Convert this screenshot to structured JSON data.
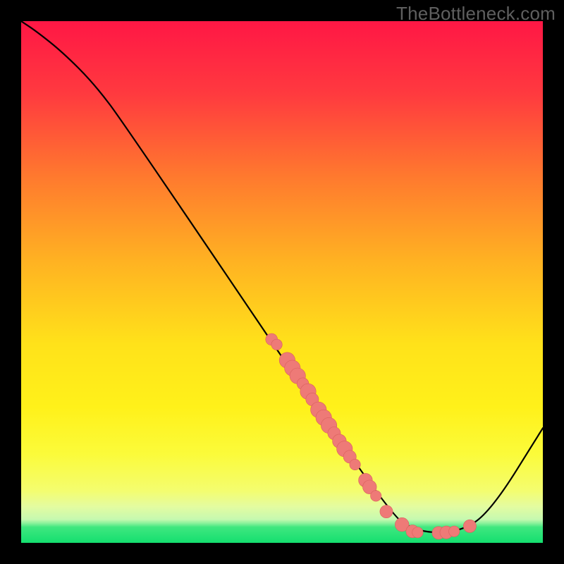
{
  "watermark": "TheBottleneck.com",
  "colors": {
    "frame": "#000000",
    "top_gradient": "#ff1846",
    "mid_gradient": "#ffe400",
    "bottom_band": "#15e070",
    "curve": "#000000",
    "point_fill": "#ee7a77",
    "point_stroke": "#d9605d"
  },
  "chart_data": {
    "type": "line",
    "title": "",
    "xlabel": "",
    "ylabel": "",
    "xlim": [
      0,
      100
    ],
    "ylim": [
      0,
      100
    ],
    "curve": [
      {
        "x": 0,
        "y": 100
      },
      {
        "x": 3,
        "y": 98
      },
      {
        "x": 8,
        "y": 94
      },
      {
        "x": 14,
        "y": 88
      },
      {
        "x": 20,
        "y": 80
      },
      {
        "x": 70,
        "y": 6
      },
      {
        "x": 76,
        "y": 2
      },
      {
        "x": 84,
        "y": 2
      },
      {
        "x": 90,
        "y": 6
      },
      {
        "x": 100,
        "y": 22
      }
    ],
    "series": [
      {
        "name": "points",
        "values": [
          {
            "x": 48,
            "y": 39,
            "r": 1.2
          },
          {
            "x": 49,
            "y": 38,
            "r": 1.1
          },
          {
            "x": 51,
            "y": 35,
            "r": 1.6
          },
          {
            "x": 52,
            "y": 33.5,
            "r": 1.6
          },
          {
            "x": 53,
            "y": 32,
            "r": 1.6
          },
          {
            "x": 54,
            "y": 30.5,
            "r": 1.2
          },
          {
            "x": 55,
            "y": 29,
            "r": 1.6
          },
          {
            "x": 55.8,
            "y": 27.5,
            "r": 1.3
          },
          {
            "x": 57,
            "y": 25.5,
            "r": 1.6
          },
          {
            "x": 58,
            "y": 24,
            "r": 1.6
          },
          {
            "x": 59,
            "y": 22.5,
            "r": 1.6
          },
          {
            "x": 60,
            "y": 21,
            "r": 1.3
          },
          {
            "x": 61,
            "y": 19.5,
            "r": 1.4
          },
          {
            "x": 62,
            "y": 18,
            "r": 1.6
          },
          {
            "x": 63,
            "y": 16.5,
            "r": 1.3
          },
          {
            "x": 64,
            "y": 15,
            "r": 1.1
          },
          {
            "x": 66,
            "y": 12,
            "r": 1.4
          },
          {
            "x": 66.8,
            "y": 10.7,
            "r": 1.4
          },
          {
            "x": 68,
            "y": 9,
            "r": 1.1
          },
          {
            "x": 70,
            "y": 6,
            "r": 1.3
          },
          {
            "x": 73,
            "y": 3.5,
            "r": 1.4
          },
          {
            "x": 75,
            "y": 2.2,
            "r": 1.3
          },
          {
            "x": 76,
            "y": 2.0,
            "r": 1.1
          },
          {
            "x": 80,
            "y": 1.9,
            "r": 1.3
          },
          {
            "x": 81.5,
            "y": 2.0,
            "r": 1.3
          },
          {
            "x": 83,
            "y": 2.2,
            "r": 1.1
          },
          {
            "x": 86,
            "y": 3.2,
            "r": 1.3
          }
        ]
      }
    ]
  }
}
